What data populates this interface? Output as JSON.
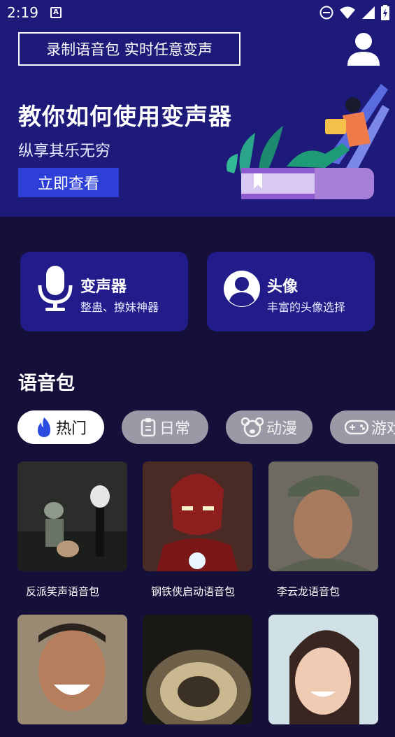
{
  "status_bar": {
    "time": "2:19"
  },
  "banner": {
    "record_button": "录制语音包 实时任意变声",
    "title": "教你如何使用变声器",
    "subtitle": "纵享其乐无穷",
    "view_button": "立即查看"
  },
  "features": [
    {
      "title": "变声器",
      "subtitle": "整蛊、撩妹神器",
      "icon": "microphone-icon"
    },
    {
      "title": "头像",
      "subtitle": "丰富的头像选择",
      "icon": "avatar-icon"
    }
  ],
  "voice_pack": {
    "section_title": "语音包",
    "tabs": [
      {
        "label": "热门",
        "icon": "fire-icon",
        "active": true
      },
      {
        "label": "日常",
        "icon": "clipboard-icon",
        "active": false
      },
      {
        "label": "动漫",
        "icon": "bear-icon",
        "active": false
      },
      {
        "label": "游戏",
        "icon": "gamepad-icon",
        "active": false
      }
    ],
    "items": [
      {
        "title": "反派笑声语音包"
      },
      {
        "title": "钢铁侠启动语音包"
      },
      {
        "title": "李云龙语音包"
      },
      {
        "title": ""
      },
      {
        "title": ""
      },
      {
        "title": ""
      }
    ]
  },
  "colors": {
    "banner_bg": "#1d1a7a",
    "page_bg": "#15103a",
    "card_bg": "#211c8a",
    "button_blue": "#2e3fd8"
  }
}
